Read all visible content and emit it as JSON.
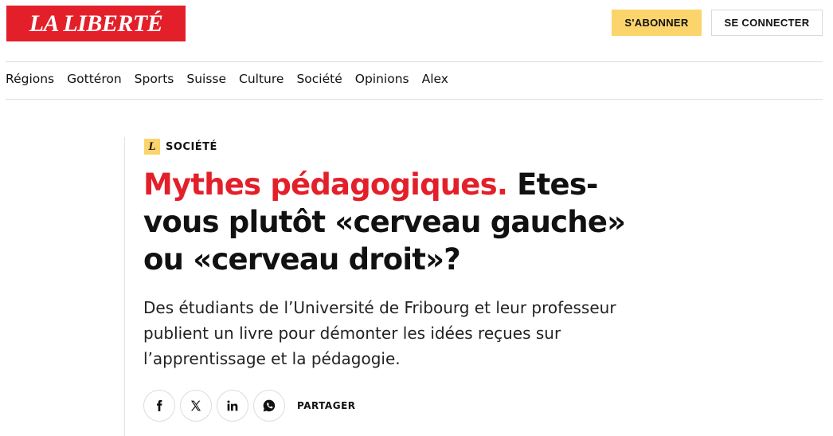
{
  "header": {
    "logo_text": "LA LIBERTÉ",
    "subscribe_label": "S'ABONNER",
    "login_label": "SE CONNECTER"
  },
  "nav": {
    "items": [
      "Régions",
      "Gottéron",
      "Sports",
      "Suisse",
      "Culture",
      "Société",
      "Opinions",
      "Alex"
    ]
  },
  "article": {
    "category_badge": "L",
    "category": "SOCIÉTÉ",
    "headline_kicker": "Mythes pédagogiques.",
    "headline_main": "Etes-vous plutôt «cerveau gauche» ou «cerveau droit»?",
    "lead": "Des étudiants de l’Université de Fribourg et leur professeur publient un livre pour démonter les idées reçues sur l’apprentissage et la pédagogie."
  },
  "share": {
    "label": "PARTAGER",
    "icons": [
      "facebook-icon",
      "x-icon",
      "linkedin-icon",
      "whatsapp-icon"
    ]
  },
  "colors": {
    "brand_red": "#e3202a",
    "accent_yellow": "#fbd46b",
    "text": "#111111"
  }
}
